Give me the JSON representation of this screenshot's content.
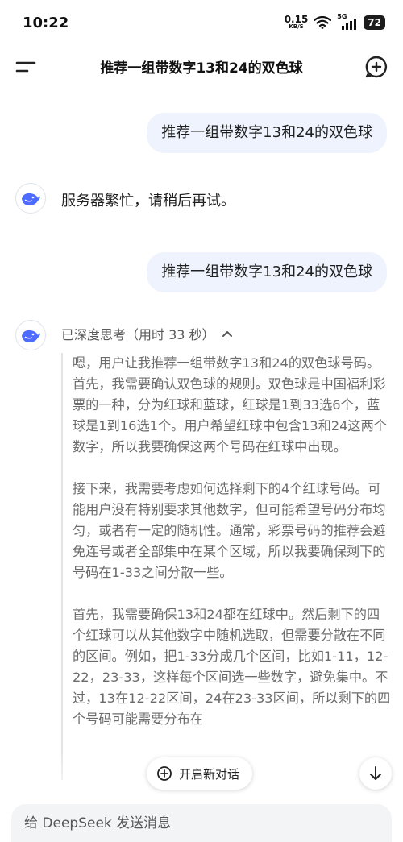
{
  "status_bar": {
    "time": "10:22",
    "net_speed": "0.15",
    "net_unit": "KB/S",
    "network_type": "5G",
    "battery": "72"
  },
  "header": {
    "title": "推荐一组带数字13和24的双色球",
    "menu_icon": "menu-icon",
    "new_chat_icon": "new-chat-icon"
  },
  "messages": [
    {
      "role": "user",
      "text": "推荐一组带数字13和24的双色球"
    },
    {
      "role": "assistant",
      "text": "服务器繁忙，请稍后再试。"
    },
    {
      "role": "user",
      "text": "推荐一组带数字13和24的双色球"
    }
  ],
  "thinking": {
    "label": "已深度思考（用时 33 秒）",
    "paragraphs": [
      "嗯，用户让我推荐一组带数字13和24的双色球号码。首先，我需要确认双色球的规则。双色球是中国福利彩票的一种，分为红球和蓝球，红球是1到33选6个，蓝球是1到16选1个。用户希望红球中包含13和24这两个数字，所以我要确保这两个号码在红球中出现。",
      "接下来，我需要考虑如何选择剩下的4个红球号码。可能用户没有特别要求其他数字，但可能希望号码分布均匀，或者有一定的随机性。通常，彩票号码的推荐会避免连号或者全部集中在某个区域，所以我要确保剩下的号码在1-33之间分散一些。",
      "首先，我需要确保13和24都在红球中。然后剩下的四个红球可以从其他数字中随机选取，但需要分散在不同的区间。例如，把1-33分成几个区间，比如1-11，12-22，23-33，这样每个区间选一些数字，避免集中。不过，13在12-22区间，24在23-33区间，所以剩下的四个号码可能需要分布在"
    ]
  },
  "floating": {
    "new_chat_label": "开启新对话"
  },
  "input": {
    "placeholder": "给 DeepSeek 发送消息"
  }
}
